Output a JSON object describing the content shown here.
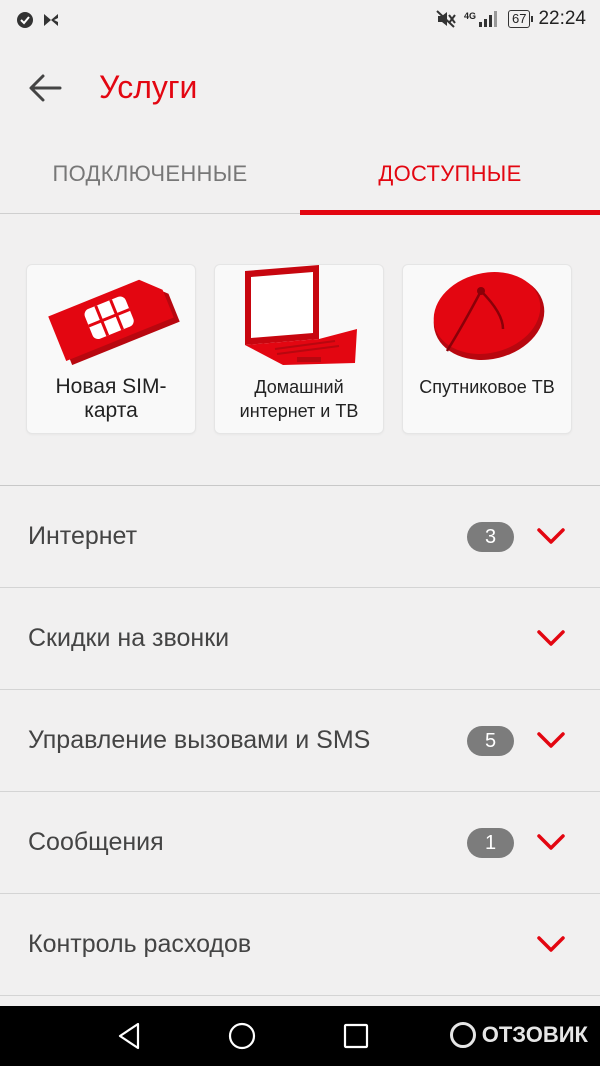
{
  "status_bar": {
    "network": "4G",
    "battery": "67",
    "time": "22:24"
  },
  "app_bar": {
    "title": "Услуги"
  },
  "tabs": [
    {
      "label": "ПОДКЛЮЧЕННЫЕ",
      "active": false
    },
    {
      "label": "ДОСТУПНЫЕ",
      "active": true
    }
  ],
  "cards": [
    {
      "label": "Новая SIM-карта",
      "icon": "sim-card-icon"
    },
    {
      "label": "Домашний интернет и ТВ",
      "icon": "laptop-icon"
    },
    {
      "label": "Спутниковое ТВ",
      "icon": "satellite-dish-icon"
    }
  ],
  "categories": [
    {
      "label": "Интернет",
      "badge": "3"
    },
    {
      "label": "Скидки на звонки",
      "badge": ""
    },
    {
      "label": "Управление вызовами и SMS",
      "badge": "5"
    },
    {
      "label": "Сообщения",
      "badge": "1"
    },
    {
      "label": "Контроль расходов",
      "badge": ""
    }
  ],
  "watermark": "ОТЗОВИК",
  "colors": {
    "accent": "#e30611",
    "background": "#f1f0f0",
    "badge": "#7c7c7c"
  }
}
